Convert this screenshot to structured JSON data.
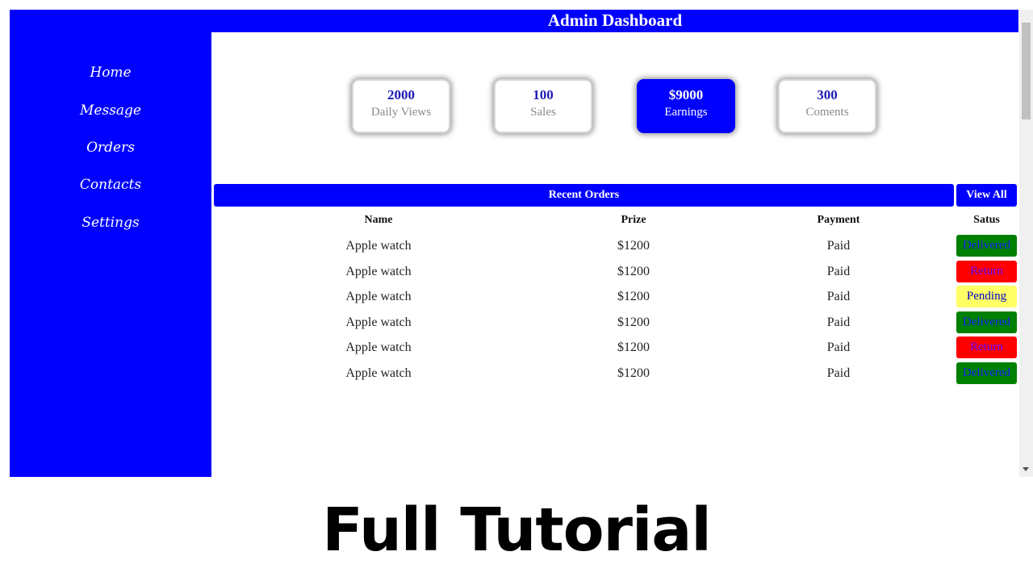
{
  "header": {
    "title": "Admin Dashboard"
  },
  "sidebar": {
    "items": [
      {
        "label": "Home"
      },
      {
        "label": "Message"
      },
      {
        "label": "Orders"
      },
      {
        "label": "Contacts"
      },
      {
        "label": "Settings"
      }
    ]
  },
  "cards": [
    {
      "value": "2000",
      "label": "Daily Views",
      "active": false
    },
    {
      "value": "100",
      "label": "Sales",
      "active": false
    },
    {
      "value": "$9000",
      "label": "Earnings",
      "active": true
    },
    {
      "value": "300",
      "label": "Coments",
      "active": false
    }
  ],
  "orders": {
    "title": "Recent Orders",
    "view_all_label": "View All",
    "columns": [
      "Name",
      "Prize",
      "Payment",
      "Satus"
    ],
    "rows": [
      {
        "name": "Apple watch",
        "prize": "$1200",
        "payment": "Paid",
        "status": "Delivered"
      },
      {
        "name": "Apple watch",
        "prize": "$1200",
        "payment": "Paid",
        "status": "Return"
      },
      {
        "name": "Apple watch",
        "prize": "$1200",
        "payment": "Paid",
        "status": "Pending"
      },
      {
        "name": "Apple watch",
        "prize": "$1200",
        "payment": "Paid",
        "status": "Delivered"
      },
      {
        "name": "Apple watch",
        "prize": "$1200",
        "payment": "Paid",
        "status": "Return"
      },
      {
        "name": "Apple watch",
        "prize": "$1200",
        "payment": "Paid",
        "status": "Delivered"
      }
    ]
  },
  "status_colors": {
    "Delivered": {
      "bg": "#008000",
      "fg": "#1a1aff"
    },
    "Return": {
      "bg": "#ff0000",
      "fg": "#5a00ff"
    },
    "Pending": {
      "bg": "#ffff66",
      "fg": "#0000cc"
    }
  },
  "colors": {
    "primary": "#0000ff",
    "card_value": "#1c1cb4",
    "card_label": "#8a8a8a"
  },
  "caption": {
    "text": "Full Tutorial"
  }
}
